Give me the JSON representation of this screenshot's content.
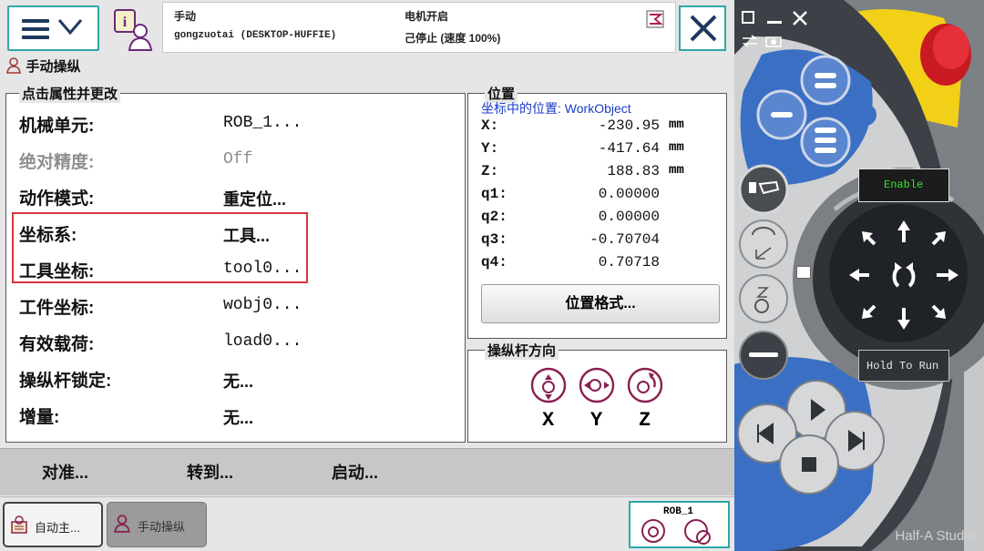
{
  "status": {
    "mode": "手动",
    "station": "gongzuotai (DESKTOP-HUFFIE)",
    "motor": "电机开启",
    "state": "己停止 (速度 100%)"
  },
  "title": "手动操纵",
  "props": {
    "legend": "点击属性并更改",
    "rows": [
      {
        "label": "机械单元:",
        "value": "ROB_1..."
      },
      {
        "label": "绝对精度:",
        "value": "Off"
      },
      {
        "label": "动作模式:",
        "value": "重定位..."
      },
      {
        "label": "坐标系:",
        "value": "工具..."
      },
      {
        "label": "工具坐标:",
        "value": "tool0..."
      },
      {
        "label": "工件坐标:",
        "value": "wobj0..."
      },
      {
        "label": "有效载荷:",
        "value": "load0..."
      },
      {
        "label": "操纵杆锁定:",
        "value": "无..."
      },
      {
        "label": "增量:",
        "value": "无..."
      }
    ]
  },
  "position": {
    "legend": "位置",
    "header": "坐标中的位置: WorkObject",
    "rows": [
      {
        "label": "X:",
        "value": "-230.95",
        "unit": "mm"
      },
      {
        "label": "Y:",
        "value": "-417.64",
        "unit": "mm"
      },
      {
        "label": "Z:",
        "value": "188.83",
        "unit": "mm"
      },
      {
        "label": "q1:",
        "value": "0.00000",
        "unit": ""
      },
      {
        "label": "q2:",
        "value": "0.00000",
        "unit": ""
      },
      {
        "label": "q3:",
        "value": "-0.70704",
        "unit": ""
      },
      {
        "label": "q4:",
        "value": "0.70718",
        "unit": ""
      }
    ],
    "format_button": "位置格式..."
  },
  "joystick": {
    "legend": "操纵杆方向",
    "axes": [
      "X",
      "Y",
      "Z"
    ]
  },
  "actions": [
    "对准...",
    "转到...",
    "启动..."
  ],
  "taskbar": {
    "auto_tab": "自动主...",
    "jog_tab": "手动操纵",
    "robot": "ROB_1"
  },
  "device": {
    "enable": "Enable",
    "hold_to_run": "Hold To Run",
    "watermark": "Half-A Studio"
  },
  "colors": {
    "accent": "#2fa7a8",
    "highlight": "#d9363e",
    "position_header": "#1a3cc9",
    "device_blue": "#3a6fc4",
    "emergency_red": "#d8262e",
    "enable_green": "#2ee82e"
  }
}
